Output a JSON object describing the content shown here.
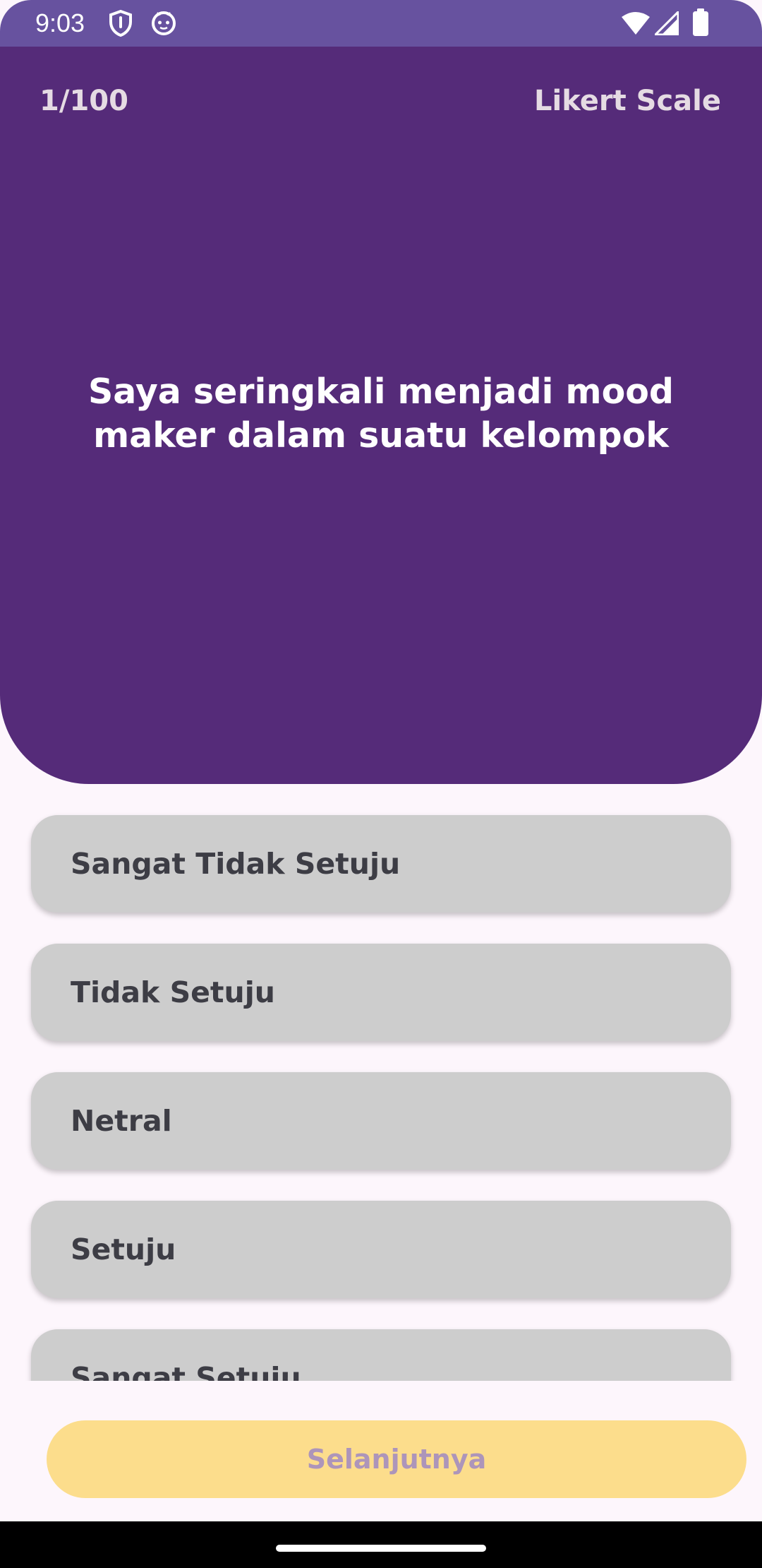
{
  "status_bar": {
    "time": "9:03",
    "left_icons": [
      "shield-icon",
      "cat-face-icon"
    ],
    "right_icons": [
      "wifi-icon",
      "cell-signal-icon",
      "battery-icon"
    ]
  },
  "header": {
    "progress": "1/100",
    "question_type": "Likert Scale",
    "question": "Saya seringkali menjadi mood maker dalam suatu kelompok"
  },
  "options": [
    {
      "label": "Sangat Tidak Setuju"
    },
    {
      "label": "Tidak Setuju"
    },
    {
      "label": "Netral"
    },
    {
      "label": "Setuju"
    },
    {
      "label": "Sangat Setuju"
    }
  ],
  "next_button": {
    "label": "Selanjutnya"
  },
  "colors": {
    "status_bar": "#67529f",
    "header": "#552b79",
    "option_bg": "#cdcdcd",
    "button_bg": "#fcdd8c",
    "button_text": "#ad95ba",
    "page_bg": "#fdf6fc"
  }
}
